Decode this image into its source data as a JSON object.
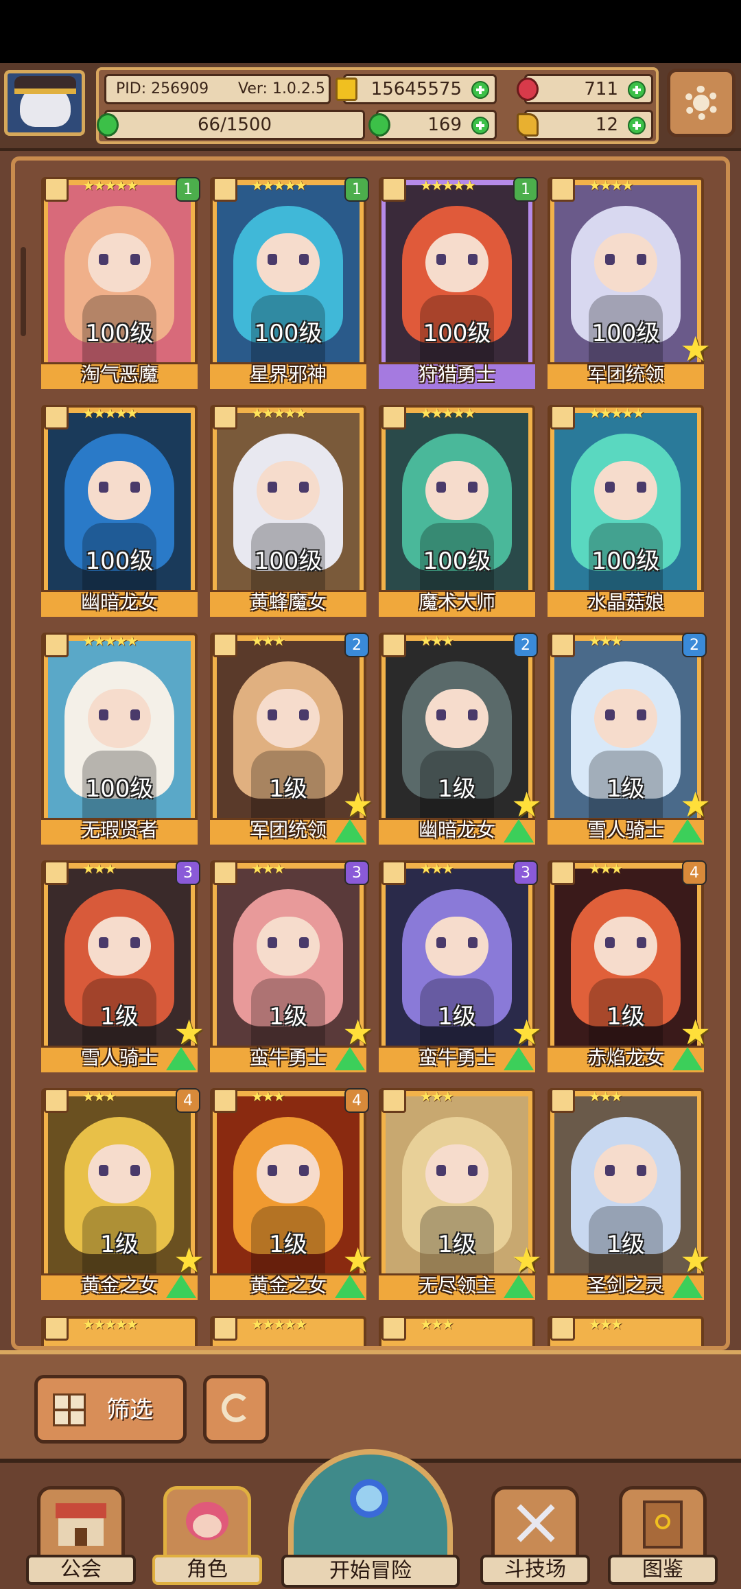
{
  "header": {
    "pid": "PID: 256909",
    "version": "Ver: 1.0.2.5",
    "gold": "15645575",
    "gems": "711",
    "stamina": "66/1500",
    "clover": "169",
    "keys": "12",
    "colors": {
      "gold": "#f0c020",
      "gem": "#d83a4a",
      "clover": "#3cc048",
      "key": "#e8b030"
    }
  },
  "characters": [
    {
      "name": "淘气恶魔",
      "level": "100级",
      "stars": "★★★★★",
      "badge": "1",
      "badge_color": "#4cae4c",
      "rarity": "gold",
      "fav": false,
      "up": false,
      "hair": "#f0b08a",
      "bg": "#d86a7a"
    },
    {
      "name": "星界邪神",
      "level": "100级",
      "stars": "★★★★★",
      "badge": "1",
      "badge_color": "#4cae4c",
      "rarity": "gold",
      "fav": false,
      "up": false,
      "hair": "#40b8d8",
      "bg": "#2a5a8a"
    },
    {
      "name": "狩猎勇士",
      "level": "100级",
      "stars": "★★★★★",
      "badge": "1",
      "badge_color": "#4cae4c",
      "rarity": "purple",
      "fav": false,
      "up": false,
      "hair": "#e05a3a",
      "bg": "#3a2a3a"
    },
    {
      "name": "军团统领",
      "level": "100级",
      "stars": "★★★★",
      "badge": "",
      "badge_color": "",
      "rarity": "gold",
      "fav": true,
      "up": false,
      "hair": "#d8d8f0",
      "bg": "#6a5a8a"
    },
    {
      "name": "幽暗龙女",
      "level": "100级",
      "stars": "★★★★★",
      "badge": "",
      "badge_color": "",
      "rarity": "gold",
      "fav": false,
      "up": false,
      "hair": "#2a7ac8",
      "bg": "#1a3a5a"
    },
    {
      "name": "黄蜂魔女",
      "level": "100级",
      "stars": "★★★★★",
      "badge": "",
      "badge_color": "",
      "rarity": "gold",
      "fav": false,
      "up": false,
      "hair": "#e8e8f0",
      "bg": "#7a5a3a"
    },
    {
      "name": "魔术大师",
      "level": "100级",
      "stars": "★★★★★",
      "badge": "",
      "badge_color": "",
      "rarity": "gold",
      "fav": false,
      "up": false,
      "hair": "#4ab89a",
      "bg": "#2a4a4a"
    },
    {
      "name": "水晶菇娘",
      "level": "100级",
      "stars": "★★★★★",
      "badge": "",
      "badge_color": "",
      "rarity": "gold",
      "fav": false,
      "up": false,
      "hair": "#5ad8c0",
      "bg": "#2a7a9a"
    },
    {
      "name": "无瑕贤者",
      "level": "100级",
      "stars": "★★★★★",
      "badge": "",
      "badge_color": "",
      "rarity": "gold",
      "fav": false,
      "up": false,
      "hair": "#f4f0e8",
      "bg": "#5aa8c8"
    },
    {
      "name": "军团统领",
      "level": "1级",
      "stars": "★★★",
      "badge": "2",
      "badge_color": "#3a8ad8",
      "rarity": "gold",
      "fav": true,
      "up": true,
      "hair": "#e0b080",
      "bg": "#5a3a2a"
    },
    {
      "name": "幽暗龙女",
      "level": "1级",
      "stars": "★★★",
      "badge": "2",
      "badge_color": "#3a8ad8",
      "rarity": "gold",
      "fav": true,
      "up": true,
      "hair": "#5a6a6a",
      "bg": "#2a2a2a"
    },
    {
      "name": "雪人骑士",
      "level": "1级",
      "stars": "★★★",
      "badge": "2",
      "badge_color": "#3a8ad8",
      "rarity": "gold",
      "fav": true,
      "up": true,
      "hair": "#d8e8f8",
      "bg": "#4a6a8a"
    },
    {
      "name": "雪人骑士",
      "level": "1级",
      "stars": "★★★",
      "badge": "3",
      "badge_color": "#8a5ad8",
      "rarity": "gold",
      "fav": true,
      "up": true,
      "hair": "#d85a3a",
      "bg": "#3a2a2a"
    },
    {
      "name": "蛮牛勇士",
      "level": "1级",
      "stars": "★★★",
      "badge": "3",
      "badge_color": "#8a5ad8",
      "rarity": "gold",
      "fav": true,
      "up": true,
      "hair": "#e89a9a",
      "bg": "#5a3a3a"
    },
    {
      "name": "蛮牛勇士",
      "level": "1级",
      "stars": "★★★",
      "badge": "3",
      "badge_color": "#8a5ad8",
      "rarity": "gold",
      "fav": true,
      "up": true,
      "hair": "#8a7ad8",
      "bg": "#2a2a4a"
    },
    {
      "name": "赤焰龙女",
      "level": "1级",
      "stars": "★★★",
      "badge": "4",
      "badge_color": "#d88a3a",
      "rarity": "gold",
      "fav": true,
      "up": true,
      "hair": "#e0603a",
      "bg": "#3a1a1a"
    },
    {
      "name": "黄金之女",
      "level": "1级",
      "stars": "★★★",
      "badge": "4",
      "badge_color": "#d88a3a",
      "rarity": "gold",
      "fav": true,
      "up": true,
      "hair": "#e8c048",
      "bg": "#6a5020"
    },
    {
      "name": "黄金之女",
      "level": "1级",
      "stars": "★★★",
      "badge": "4",
      "badge_color": "#d88a3a",
      "rarity": "gold",
      "fav": true,
      "up": true,
      "hair": "#f09a30",
      "bg": "#8a2a10"
    },
    {
      "name": "无尽领主",
      "level": "1级",
      "stars": "★★★",
      "badge": "",
      "badge_color": "",
      "rarity": "gold",
      "fav": true,
      "up": true,
      "hair": "#e8d098",
      "bg": "#c8a870"
    },
    {
      "name": "圣剑之灵",
      "level": "1级",
      "stars": "★★★",
      "badge": "",
      "badge_color": "",
      "rarity": "gold",
      "fav": true,
      "up": true,
      "hair": "#c8d8f0",
      "bg": "#6a5a4a"
    }
  ],
  "partial_row_stars": [
    "★★★★★",
    "★★★★★",
    "★★★",
    "★★★"
  ],
  "toolbar": {
    "filter_label": "筛选"
  },
  "nav": {
    "guild": "公会",
    "characters": "角色",
    "adventure": "开始冒险",
    "arena": "斗技场",
    "codex": "图鉴"
  }
}
